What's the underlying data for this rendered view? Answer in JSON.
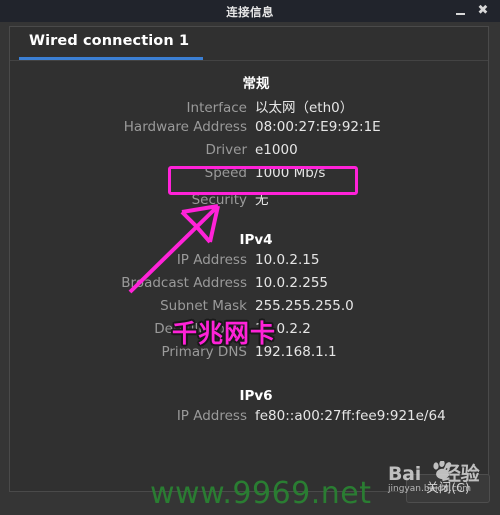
{
  "window": {
    "title": "连接信息",
    "minimize_icon": "minimize-icon",
    "close_icon": "close-icon"
  },
  "tabs": [
    {
      "label": "Wired connection 1",
      "active": true
    }
  ],
  "sections": [
    {
      "heading": "常规",
      "rows": [
        {
          "label": "Interface",
          "value": "以太网（eth0）"
        },
        {
          "label": "Hardware Address",
          "value": "08:00:27:E9:92:1E"
        },
        {
          "label": "Driver",
          "value": "e1000"
        },
        {
          "label": "Speed",
          "value": "1000 Mb/s"
        },
        {
          "label": "Security",
          "value": "无"
        }
      ]
    },
    {
      "heading": "IPv4",
      "rows": [
        {
          "label": "IP Address",
          "value": "10.0.2.15"
        },
        {
          "label": "Broadcast Address",
          "value": "10.0.2.255"
        },
        {
          "label": "Subnet Mask",
          "value": "255.255.255.0"
        },
        {
          "label": "Default Route",
          "value": "10.0.2.2"
        },
        {
          "label": "Primary DNS",
          "value": "192.168.1.1"
        }
      ]
    },
    {
      "heading": "IPv6",
      "rows": [
        {
          "label": "IP Address",
          "value": "fe80::a00:27ff:fee9:921e/64"
        }
      ]
    }
  ],
  "buttons": {
    "close": "关闭(C)"
  },
  "annotations": {
    "gigabit_note": "千兆网卡",
    "highlight_color": "#ff22d8"
  },
  "watermarks": {
    "site": "www.9969.net",
    "baidu_main": "Bai",
    "baidu_main2": "经验",
    "baidu_du": "du",
    "baidu_sub": "jingyan.baidu.com"
  }
}
